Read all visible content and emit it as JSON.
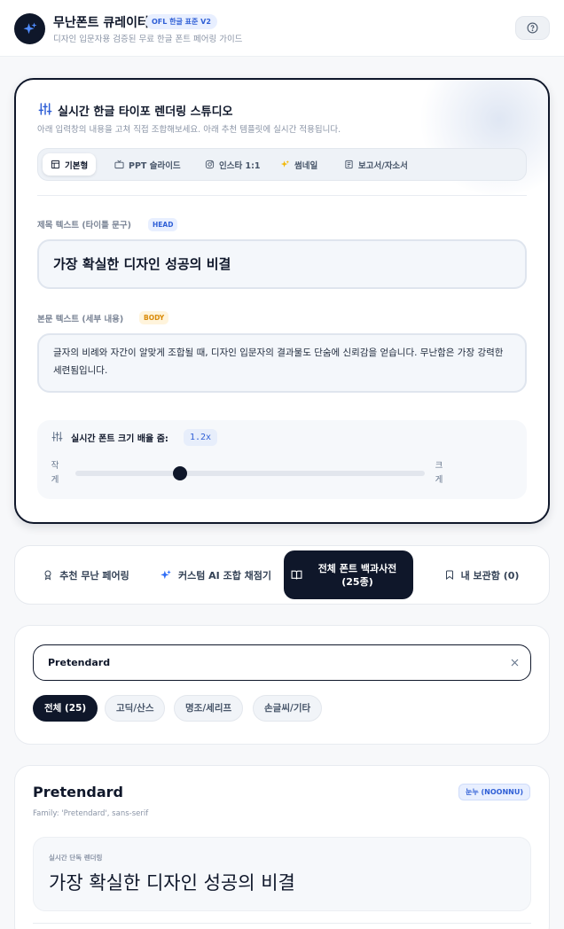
{
  "header": {
    "title": "무난폰트 큐레이터",
    "badge": "OFL 한글 표준 V2",
    "subtitle": "디자인 입문자용 검증된 무료 한글 폰트 페어링 가이드"
  },
  "studio": {
    "title": "실시간 한글 타이포 렌더링 스튜디오",
    "description": "아래 입력창의 내용을 고쳐 직접 조합해보세요. 아래 추천 템플릿에 실시간 적용됩니다.",
    "template_tabs": [
      {
        "label": "기본형",
        "icon": "layout-icon",
        "active": true
      },
      {
        "label": "PPT 슬라이드",
        "icon": "tv-icon",
        "active": false
      },
      {
        "label": "인스타 1:1",
        "icon": "instagram-icon",
        "active": false
      },
      {
        "label": "썸네일",
        "icon": "sparkle-icon",
        "active": false
      },
      {
        "label": "보고서/자소서",
        "icon": "document-icon",
        "active": false
      }
    ],
    "head_field": {
      "label": "제목 텍스트 (타이틀 문구)",
      "tag": "HEAD",
      "value": "가장 확실한 디자인 성공의 비결"
    },
    "body_field": {
      "label": "본문 텍스트 (세부 내용)",
      "tag": "BODY",
      "value": "글자의 비례와 자간이 알맞게 조합될 때, 디자인 입문자의 결과물도 단숨에 신뢰감을 얻습니다. 무난함은 가장 강력한 세련됨입니다."
    },
    "scale": {
      "label": "실시간 폰트 크기 배율 줌:",
      "value": "1.2x",
      "small_label": "작게",
      "large_label": "크게",
      "level_fraction": 0.3
    }
  },
  "section_tabs": [
    {
      "label": "추천 무난 페어링",
      "icon": "award-icon",
      "active": false
    },
    {
      "label": "커스텀 AI 조합 채점기",
      "icon": "sparkle-icon",
      "active": false
    },
    {
      "label": "전체 폰트 백과사전 (25종)",
      "icon": "book-icon",
      "active": true
    },
    {
      "label": "내 보관함 (0)",
      "icon": "bookmark-icon",
      "active": false
    }
  ],
  "search": {
    "value": "Pretendard",
    "filters": [
      {
        "label": "전체 (25)",
        "active": true
      },
      {
        "label": "고딕/산스",
        "active": false
      },
      {
        "label": "명조/세리프",
        "active": false
      },
      {
        "label": "손글씨/기타",
        "active": false
      }
    ]
  },
  "font_card": {
    "name": "Pretendard",
    "badge": "눈누 (NOONNU)",
    "family": "Family: 'Pretendard', sans-serif",
    "preview_label": "실시간 단독 렌더링",
    "preview_text": "가장 확실한 디자인 성공의 비결"
  },
  "colors": {
    "primary": "#0f172a",
    "accent": "#2f5fd6",
    "body_tag": "#d98a08",
    "background": "#f7f8fa"
  }
}
